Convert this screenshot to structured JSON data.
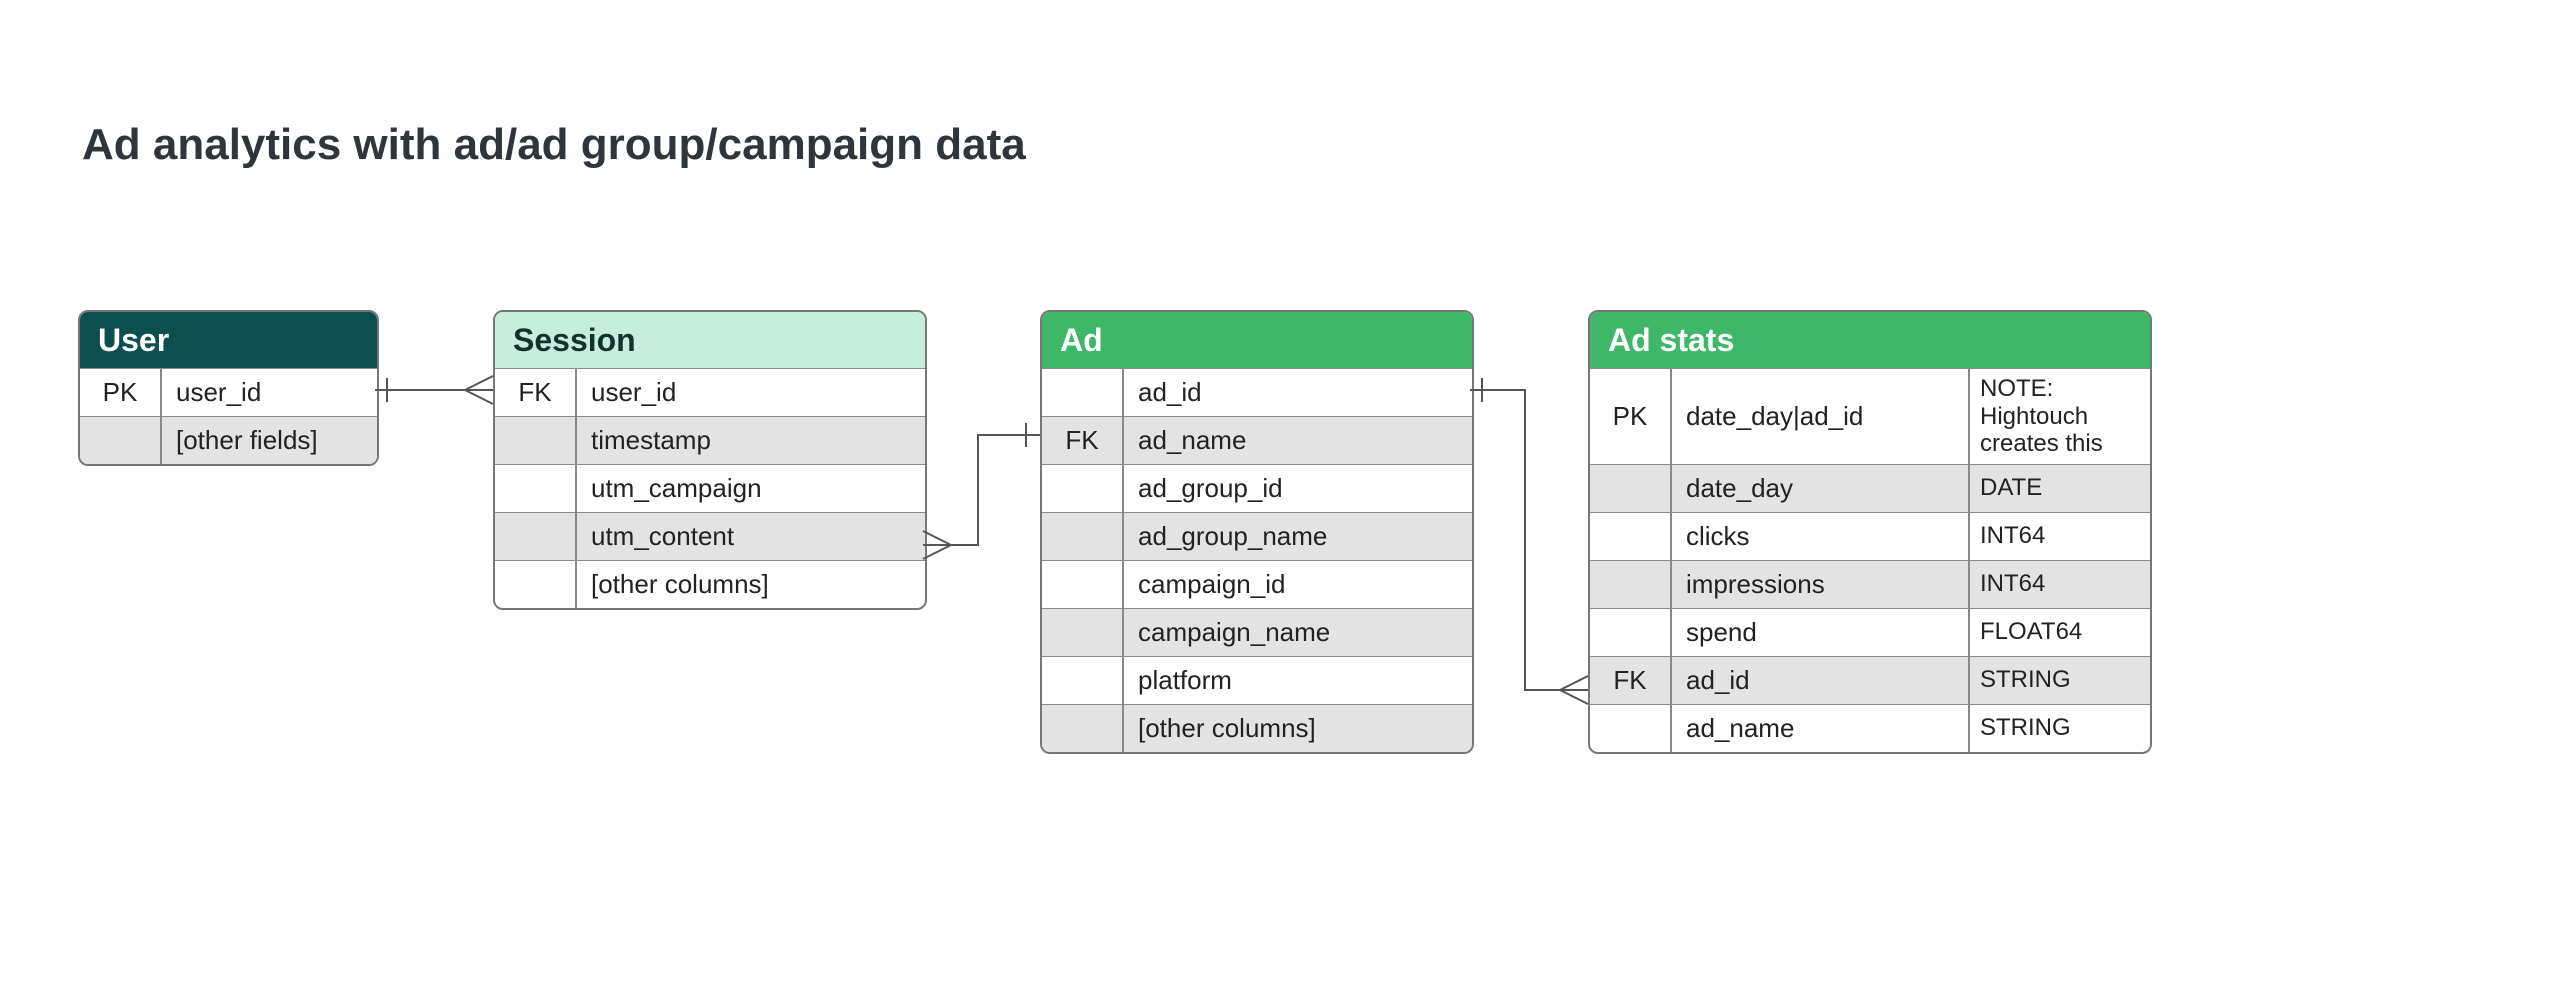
{
  "title": "Ad analytics with ad/ad group/campaign data",
  "entities": {
    "user": {
      "name": "User",
      "rows": [
        {
          "key": "PK",
          "name": "user_id"
        },
        {
          "key": "",
          "name": "[other fields]"
        }
      ]
    },
    "session": {
      "name": "Session",
      "rows": [
        {
          "key": "FK",
          "name": "user_id"
        },
        {
          "key": "",
          "name": "timestamp"
        },
        {
          "key": "",
          "name": "utm_campaign"
        },
        {
          "key": "",
          "name": "utm_content"
        },
        {
          "key": "",
          "name": "[other columns]"
        }
      ]
    },
    "ad": {
      "name": "Ad",
      "rows": [
        {
          "key": "",
          "name": "ad_id"
        },
        {
          "key": "FK",
          "name": "ad_name"
        },
        {
          "key": "",
          "name": "ad_group_id"
        },
        {
          "key": "",
          "name": "ad_group_name"
        },
        {
          "key": "",
          "name": "campaign_id"
        },
        {
          "key": "",
          "name": "campaign_name"
        },
        {
          "key": "",
          "name": "platform"
        },
        {
          "key": "",
          "name": "[other columns]"
        }
      ]
    },
    "adstats": {
      "name": "Ad stats",
      "rows": [
        {
          "key": "PK",
          "name": "date_day|ad_id",
          "note": "NOTE: Hightouch creates this"
        },
        {
          "key": "",
          "name": "date_day",
          "note": "DATE"
        },
        {
          "key": "",
          "name": "clicks",
          "note": "INT64"
        },
        {
          "key": "",
          "name": "impressions",
          "note": "INT64"
        },
        {
          "key": "",
          "name": "spend",
          "note": "FLOAT64"
        },
        {
          "key": "FK",
          "name": "ad_id",
          "note": "STRING"
        },
        {
          "key": "",
          "name": "ad_name",
          "note": "STRING"
        }
      ]
    }
  }
}
